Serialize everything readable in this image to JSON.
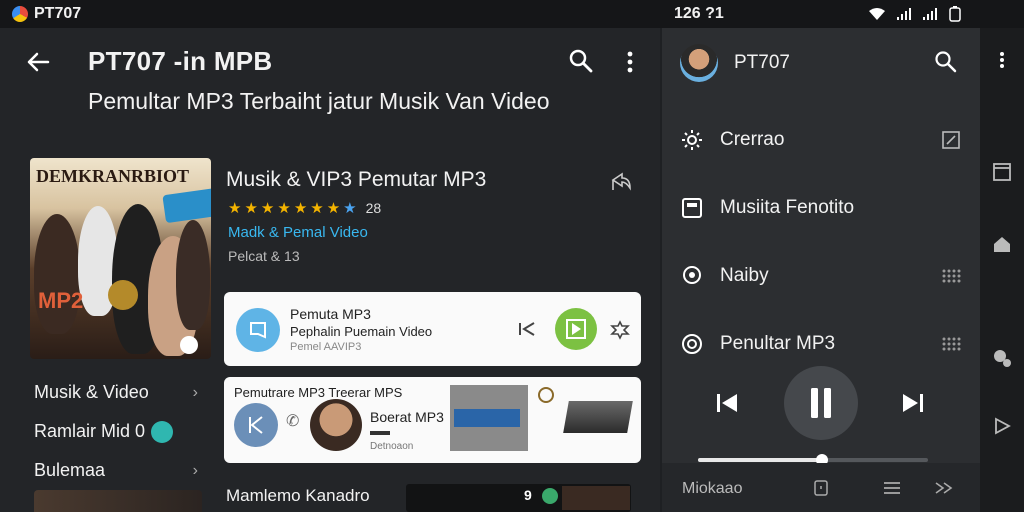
{
  "status_bar": {
    "app_name": "PT707",
    "clock": "126 ?1"
  },
  "header": {
    "title": "PT707 -in MPB",
    "subtitle": "Pemultar MP3 Terbaiht jatur Musik Van Video"
  },
  "cover": {
    "title": "DEMKRANRBIOT",
    "mp2_text": "MP2"
  },
  "left_list": [
    {
      "label": "Musik & Video"
    },
    {
      "label": "Ramlair Mid 0"
    },
    {
      "label": "Bulemaa"
    }
  ],
  "app": {
    "name": "Musik & VIP3 Pemutar MP3",
    "rating_count": "28",
    "stars_full": 7,
    "category": "Madk & Pemal Video",
    "meta": "Pelcat & 13"
  },
  "card1": {
    "line1": "Pemuta MP3",
    "line2": "Pephalin Puemain Video",
    "line3": "Pemel AAVIP3"
  },
  "card2": {
    "line1": "Pemutrare MP3 Treerar MPS",
    "line2": "Boerat MP3",
    "line3": "Detnoaon"
  },
  "bottom": {
    "title": "Mamlemo Kanadro",
    "number": "9"
  },
  "drawer": {
    "title": "PT707",
    "menu": [
      {
        "label": "Crerrao",
        "icon": "gear-icon",
        "right_icon": "edit-icon"
      },
      {
        "label": "Musiita Fenotito",
        "icon": "album-icon",
        "right_icon": ""
      },
      {
        "label": "Naiby",
        "icon": "chat-bubble-icon",
        "right_icon": "grid-dots-icon"
      },
      {
        "label": "Penultar MP3",
        "icon": "vinyl-icon",
        "right_icon": "grid-dots-icon"
      }
    ],
    "progress": 0.54,
    "bottom_label": "Miokaao"
  }
}
